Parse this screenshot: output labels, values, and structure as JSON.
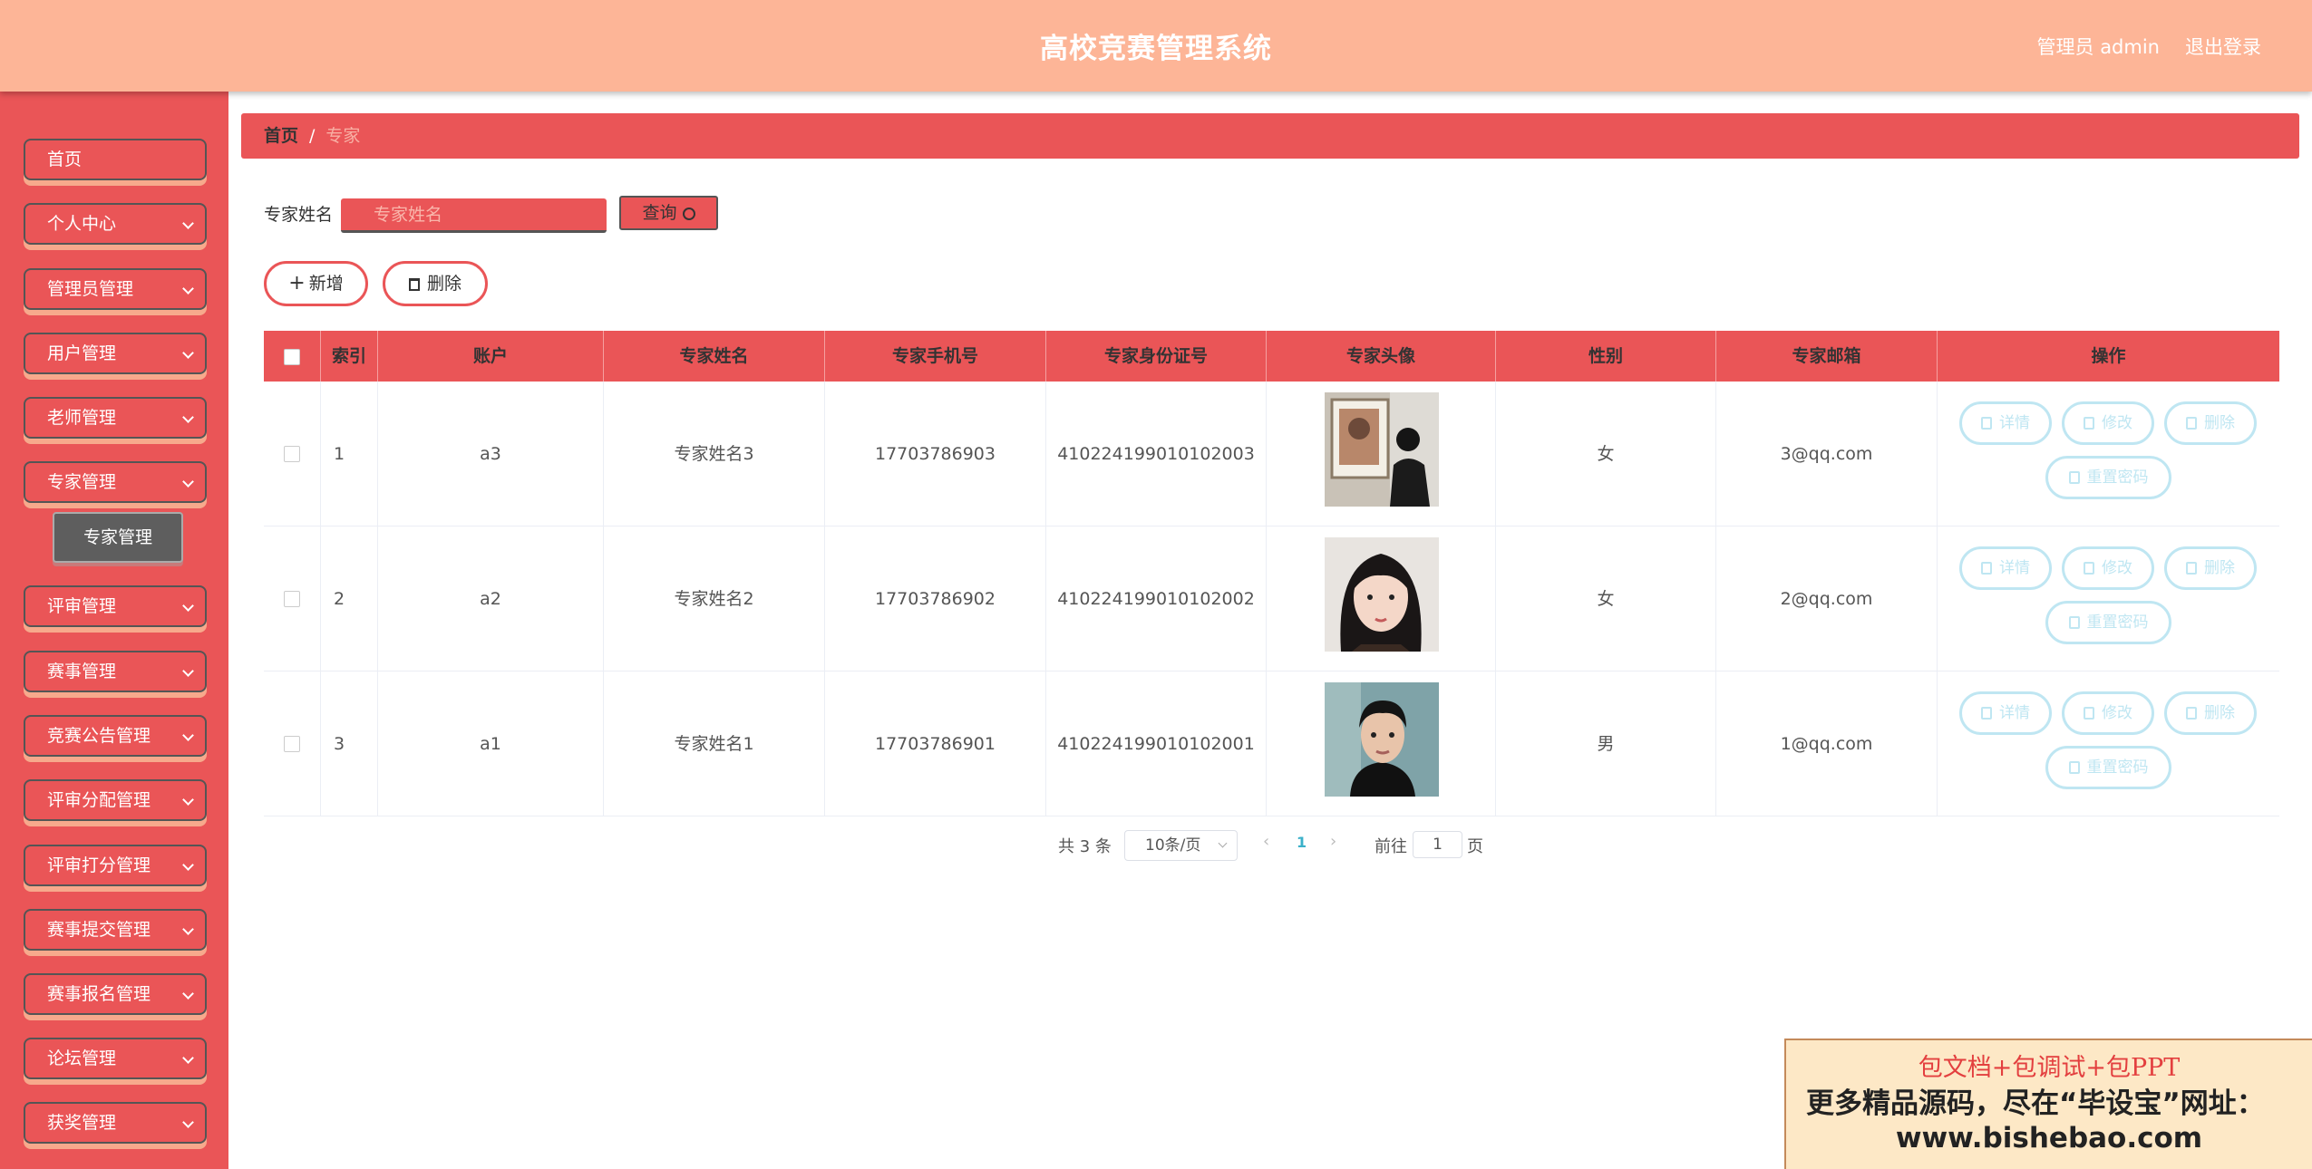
{
  "header": {
    "title": "高校竞赛管理系统",
    "user": "管理员 admin",
    "logout": "退出登录"
  },
  "sidebar": {
    "items": [
      {
        "label": "首页",
        "has_children": false
      },
      {
        "label": "个人中心",
        "has_children": true
      },
      {
        "label": "管理员管理",
        "has_children": true
      },
      {
        "label": "用户管理",
        "has_children": true
      },
      {
        "label": "老师管理",
        "has_children": true
      },
      {
        "label": "专家管理",
        "has_children": true
      },
      {
        "label": "评审管理",
        "has_children": true
      },
      {
        "label": "赛事管理",
        "has_children": true
      },
      {
        "label": "竞赛公告管理",
        "has_children": true
      },
      {
        "label": "评审分配管理",
        "has_children": true
      },
      {
        "label": "评审打分管理",
        "has_children": true
      },
      {
        "label": "赛事提交管理",
        "has_children": true
      },
      {
        "label": "赛事报名管理",
        "has_children": true
      },
      {
        "label": "论坛管理",
        "has_children": true
      },
      {
        "label": "获奖管理",
        "has_children": true
      }
    ],
    "active_sub": "专家管理"
  },
  "breadcrumb": {
    "home": "首页",
    "separator": "/",
    "current": "专家"
  },
  "search": {
    "label": "专家姓名",
    "placeholder": "专家姓名",
    "button": "查询"
  },
  "actions": {
    "add": "新增",
    "delete": "删除"
  },
  "table": {
    "columns": [
      "索引",
      "账户",
      "专家姓名",
      "专家手机号",
      "专家身份证号",
      "专家头像",
      "性别",
      "专家邮箱",
      "操作"
    ],
    "rows": [
      {
        "index": "1",
        "account": "a3",
        "name": "专家姓名3",
        "phone": "17703786903",
        "id_card": "410224199010102003",
        "avatar": "photo-woman-gallery",
        "gender": "女",
        "email": "3@qq.com"
      },
      {
        "index": "2",
        "account": "a2",
        "name": "专家姓名2",
        "phone": "17703786902",
        "id_card": "410224199010102002",
        "avatar": "photo-girl-portrait",
        "gender": "女",
        "email": "2@qq.com"
      },
      {
        "index": "3",
        "account": "a1",
        "name": "专家姓名1",
        "phone": "17703786901",
        "id_card": "410224199010102001",
        "avatar": "photo-man-portrait",
        "gender": "男",
        "email": "1@qq.com"
      }
    ],
    "row_actions": {
      "detail": "详情",
      "edit": "修改",
      "delete": "删除",
      "reset": "重置密码"
    }
  },
  "pagination": {
    "total": "共 3 条",
    "page_size": "10条/页",
    "current_page": "1",
    "goto_label": "前往",
    "goto_value": "1",
    "page_suffix": "页"
  },
  "ad": {
    "line1": "包文档+包调试+包PPT",
    "line2": "更多精品源码，尽在“毕设宝”网址：",
    "line3": "www.bishebao.com"
  },
  "colors": {
    "header": "#fdb597",
    "primary": "#ea5557",
    "action_outline": "#bfe6f2"
  }
}
